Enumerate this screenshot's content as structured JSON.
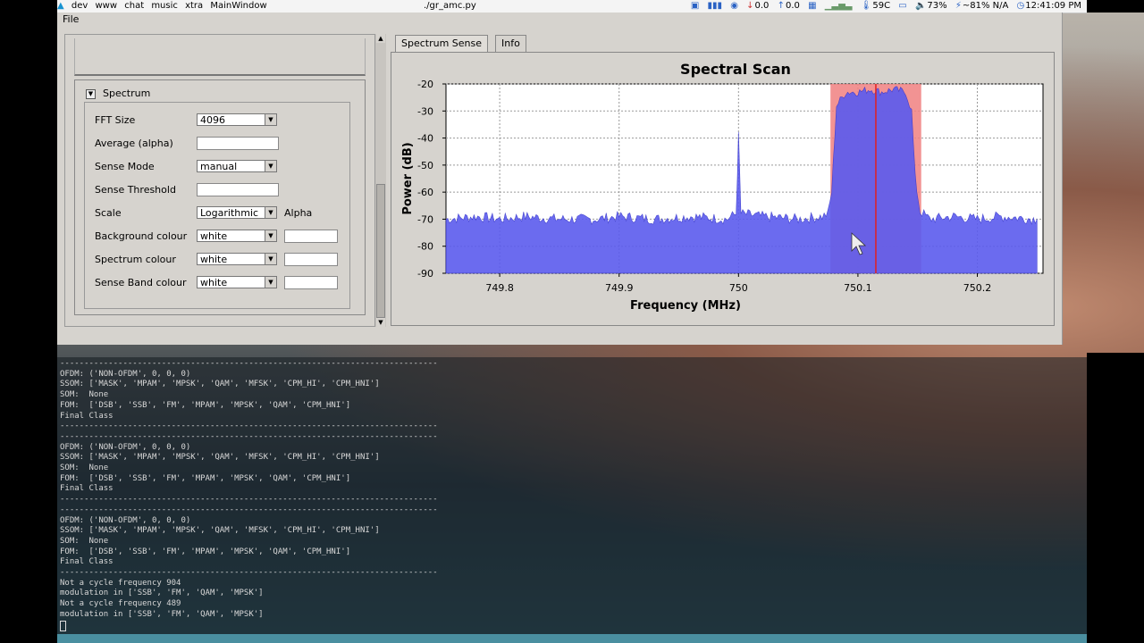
{
  "topbar": {
    "workspaces": [
      "dev",
      "www",
      "chat",
      "music",
      "xtra"
    ],
    "active_window": "MainWindow",
    "window_title": "./gr_amc.py",
    "net_down": "0.0",
    "net_up": "0.0",
    "temperature": "59C",
    "volume": "73%",
    "battery": "~81% N/A",
    "clock": "12:41:09 PM"
  },
  "menubar": {
    "file": "File"
  },
  "spectrum_group": {
    "title": "Spectrum",
    "fields": {
      "fft_size": {
        "label": "FFT Size",
        "value": "4096"
      },
      "average": {
        "label": "Average (alpha)",
        "value": ""
      },
      "sense_mode": {
        "label": "Sense Mode",
        "value": "manual"
      },
      "sense_threshold": {
        "label": "Sense Threshold",
        "value": ""
      },
      "scale": {
        "label": "Scale",
        "value": "Logarithmic",
        "side_label": "Alpha"
      },
      "background_colour": {
        "label": "Background colour",
        "value": "white"
      },
      "spectrum_colour": {
        "label": "Spectrum colour",
        "value": "white"
      },
      "sense_band_colour": {
        "label": "Sense Band colour",
        "value": "white"
      }
    }
  },
  "tabs": [
    "Spectrum Sense",
    "Info"
  ],
  "colors": {
    "spectrum_fill": "#5b5bee",
    "sense_band": "#f08080",
    "center_line": "#e02020"
  },
  "chart_data": {
    "type": "area",
    "title": "Spectral Scan",
    "xlabel": "Frequency (MHz)",
    "ylabel": "Power (dB)",
    "xlim": [
      749.755,
      750.255
    ],
    "ylim": [
      -90,
      -20
    ],
    "xticks": [
      749.8,
      749.9,
      750,
      750.1,
      750.2
    ],
    "xtick_labels": [
      "749.8",
      "749.9",
      "750",
      "750.1",
      "750.2"
    ],
    "yticks": [
      -20,
      -30,
      -40,
      -50,
      -60,
      -70,
      -80,
      -90
    ],
    "ytick_labels": [
      "-20",
      "-30",
      "-40",
      "-50",
      "-60",
      "-70",
      "-80",
      "-90"
    ],
    "grid": true,
    "noise_floor_db": -70,
    "series": [
      {
        "x": [
          749.755,
          749.78,
          749.8,
          749.82,
          749.85,
          749.88,
          749.9,
          749.93,
          749.96,
          749.99,
          749.998,
          750.0,
          750.002,
          750.02,
          750.05,
          750.07,
          750.075,
          750.078,
          750.082,
          750.09,
          750.1,
          750.11,
          750.12,
          750.13,
          750.14,
          750.145,
          750.148,
          750.152,
          750.16,
          750.18,
          750.2,
          750.22,
          750.25
        ],
        "y": [
          -70,
          -69,
          -70,
          -69,
          -70,
          -70,
          -69,
          -70,
          -69,
          -70,
          -68,
          -39,
          -68,
          -69,
          -70,
          -69,
          -68,
          -60,
          -28,
          -23,
          -23,
          -22,
          -23,
          -22,
          -23,
          -30,
          -55,
          -67,
          -70,
          -69,
          -70,
          -69,
          -70
        ]
      }
    ],
    "sense_band": {
      "x_start": 750.077,
      "x_end": 750.153
    },
    "center_marker_x": 750.115
  },
  "terminal": {
    "lines": [
      "------------------------------------------------------------------------------",
      "OFDM: ('NON-OFDM', 0, 0, 0)",
      "SSOM: ['MASK', 'MPAM', 'MPSK', 'QAM', 'MFSK', 'CPM_HI', 'CPM_HNI']",
      "SOM:  None",
      "FOM:  ['DSB', 'SSB', 'FM', 'MPAM', 'MPSK', 'QAM', 'CPM_HNI']",
      "Final Class",
      "------------------------------------------------------------------------------",
      "------------------------------------------------------------------------------",
      "OFDM: ('NON-OFDM', 0, 0, 0)",
      "SSOM: ['MASK', 'MPAM', 'MPSK', 'QAM', 'MFSK', 'CPM_HI', 'CPM_HNI']",
      "SOM:  None",
      "FOM:  ['DSB', 'SSB', 'FM', 'MPAM', 'MPSK', 'QAM', 'CPM_HNI']",
      "Final Class",
      "------------------------------------------------------------------------------",
      "------------------------------------------------------------------------------",
      "OFDM: ('NON-OFDM', 0, 0, 0)",
      "SSOM: ['MASK', 'MPAM', 'MPSK', 'QAM', 'MFSK', 'CPM_HI', 'CPM_HNI']",
      "SOM:  None",
      "FOM:  ['DSB', 'SSB', 'FM', 'MPAM', 'MPSK', 'QAM', 'CPM_HNI']",
      "Final Class",
      "------------------------------------------------------------------------------",
      "Not a cycle frequency 904",
      "modulation in ['SSB', 'FM', 'QAM', 'MPSK']",
      "Not a cycle frequency 489",
      "modulation in ['SSB', 'FM', 'QAM', 'MPSK']"
    ]
  }
}
